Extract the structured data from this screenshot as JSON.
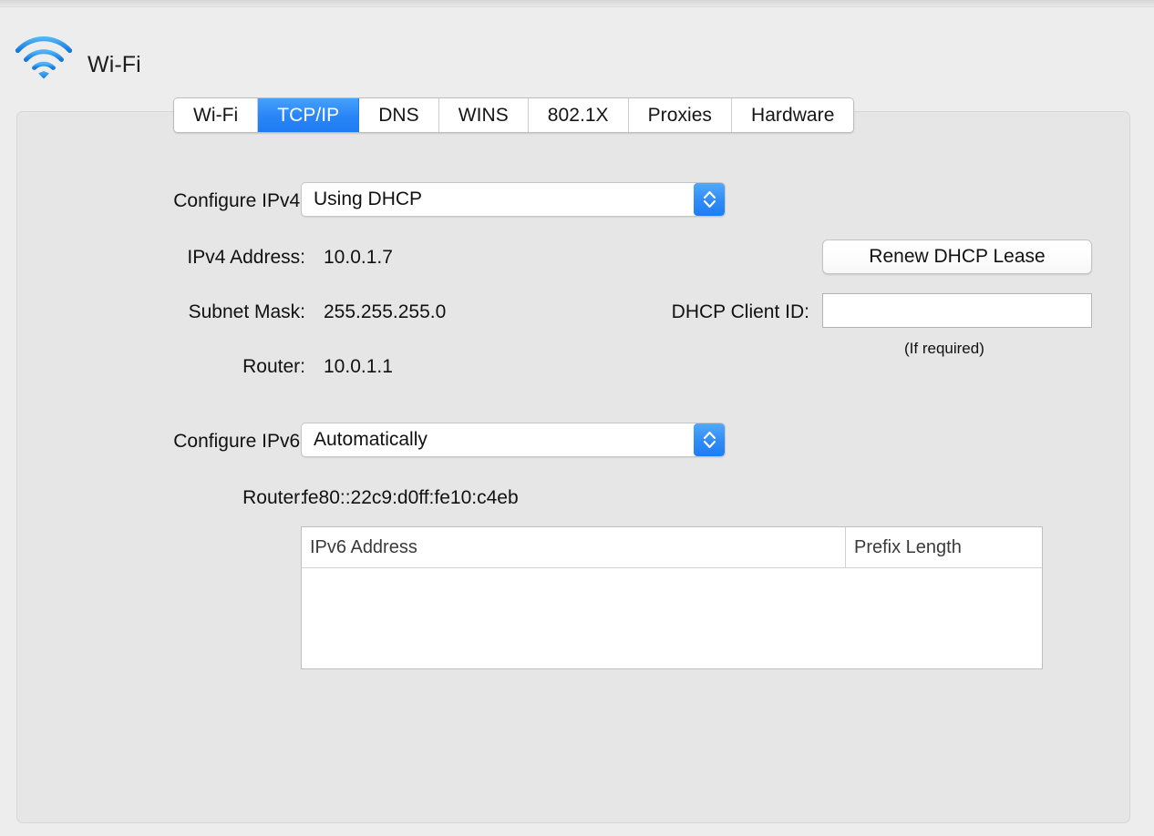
{
  "window": {
    "service_name": "Wi-Fi",
    "service_icon": "wifi-icon"
  },
  "tabs": [
    {
      "label": "Wi-Fi",
      "selected": false
    },
    {
      "label": "TCP/IP",
      "selected": true
    },
    {
      "label": "DNS",
      "selected": false
    },
    {
      "label": "WINS",
      "selected": false
    },
    {
      "label": "802.1X",
      "selected": false
    },
    {
      "label": "Proxies",
      "selected": false
    },
    {
      "label": "Hardware",
      "selected": false
    }
  ],
  "ipv4": {
    "configure_label": "Configure IPv4:",
    "configure_value": "Using DHCP",
    "address_label": "IPv4 Address:",
    "address_value": "10.0.1.7",
    "subnet_label": "Subnet Mask:",
    "subnet_value": "255.255.255.0",
    "router_label": "Router:",
    "router_value": "10.0.1.1"
  },
  "dhcp": {
    "renew_button_label": "Renew DHCP Lease",
    "client_id_label": "DHCP Client ID:",
    "client_id_value": "",
    "client_id_placeholder": "",
    "hint": "(If required)"
  },
  "ipv6": {
    "configure_label": "Configure IPv6:",
    "configure_value": "Automatically",
    "router_label": "Router:",
    "router_value": "fe80::22c9:d0ff:fe10:c4eb",
    "table": {
      "columns": [
        "IPv6 Address",
        "Prefix Length"
      ],
      "rows": []
    }
  },
  "colors": {
    "accent_blue": "#2a86f6",
    "window_background": "#ededed",
    "panel_background": "#e6e6e6",
    "wifi_icon_blue": "#2196f3"
  }
}
